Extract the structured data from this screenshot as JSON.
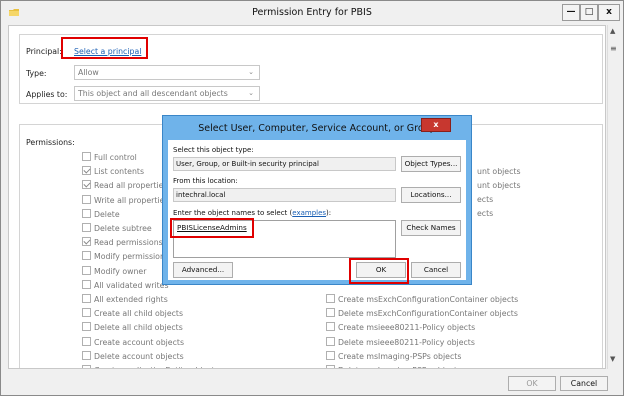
{
  "window": {
    "title": "Permission Entry for PBIS",
    "min_label": "—",
    "max_label": "□",
    "close_label": "x"
  },
  "principal": {
    "label": "Principal:",
    "link": "Select a principal"
  },
  "type": {
    "label": "Type:",
    "value": "Allow"
  },
  "applies_to": {
    "label": "Applies to:",
    "value": "This object and all descendant objects"
  },
  "permissions": {
    "label": "Permissions:",
    "left": [
      {
        "label": "Full control",
        "checked": false
      },
      {
        "label": "List contents",
        "checked": true
      },
      {
        "label": "Read all properties",
        "checked": true
      },
      {
        "label": "Write all properties",
        "checked": false
      },
      {
        "label": "Delete",
        "checked": false
      },
      {
        "label": "Delete subtree",
        "checked": false
      },
      {
        "label": "Read permissions",
        "checked": true
      },
      {
        "label": "Modify permissions",
        "checked": false
      },
      {
        "label": "Modify owner",
        "checked": false
      },
      {
        "label": "All validated writes",
        "checked": false
      },
      {
        "label": "All extended rights",
        "checked": false
      },
      {
        "label": "Create all child objects",
        "checked": false
      },
      {
        "label": "Delete all child objects",
        "checked": false
      },
      {
        "label": "Create account objects",
        "checked": false
      },
      {
        "label": "Delete account objects",
        "checked": false
      },
      {
        "label": "Create applicationEntity objects",
        "checked": false
      }
    ],
    "right_partial": [
      "unt objects",
      "unt objects",
      "ects",
      "ects"
    ],
    "right": [
      {
        "label": "Create msExchConfigurationContainer objects",
        "checked": false
      },
      {
        "label": "Delete msExchConfigurationContainer objects",
        "checked": false
      },
      {
        "label": "Create msieee80211-Policy objects",
        "checked": false
      },
      {
        "label": "Delete msieee80211-Policy objects",
        "checked": false
      },
      {
        "label": "Create msImaging-PSPs objects",
        "checked": false
      },
      {
        "label": "Delete msImaging-PSPs objects",
        "checked": false
      }
    ]
  },
  "footer": {
    "ok": "OK",
    "cancel": "Cancel"
  },
  "dialog": {
    "title": "Select User, Computer, Service Account, or Group",
    "close_label": "x",
    "object_type_label": "Select this object type:",
    "object_type_value": "User, Group, or Built-in security principal",
    "object_types_button": "Object Types...",
    "location_label": "From this location:",
    "location_value": "intechral.local",
    "locations_button": "Locations...",
    "enter_label_prefix": "Enter the object names to select (",
    "enter_label_link": "examples",
    "enter_label_suffix": "):",
    "name_value": "PBISLicenseAdmins",
    "check_names_button": "Check Names",
    "advanced_button": "Advanced...",
    "ok_button": "OK",
    "cancel_button": "Cancel"
  },
  "colors": {
    "highlight": "#e00000",
    "dialog_frame": "#6fb3ea",
    "link": "#1a5fb4"
  }
}
